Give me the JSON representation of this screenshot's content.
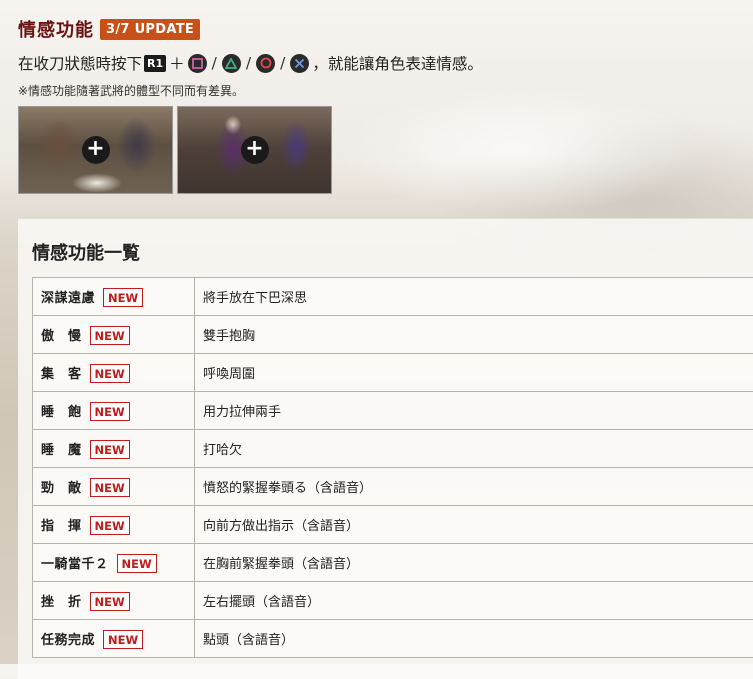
{
  "header": {
    "title": "情感功能",
    "update_badge": "3/7 UPDATE",
    "instruction_prefix": "在收刀狀態時按下",
    "button_r1": "R1",
    "plus_sign": "＋",
    "slash": "/",
    "instruction_suffix": "，就能讓角色表達情感。",
    "note": "※情感功能隨著武將的體型不同而有差異。",
    "buttons": [
      "square-button-icon",
      "triangle-button-icon",
      "circle-button-icon",
      "cross-button-icon"
    ],
    "button_colors": {
      "square": "#d25fa2",
      "triangle": "#3fb28a",
      "circle": "#e5464c",
      "cross": "#6b9ad9"
    }
  },
  "thumbnails": [
    {
      "plus": "+"
    },
    {
      "plus": "+"
    }
  ],
  "section": {
    "title": "情感功能一覧",
    "new_label": "NEW",
    "rows": [
      {
        "name": "深謀遠慮",
        "desc": "將手放在下巴深思"
      },
      {
        "name": "傲　慢",
        "desc": "雙手抱胸"
      },
      {
        "name": "集　客",
        "desc": "呼喚周圍"
      },
      {
        "name": "睡　飽",
        "desc": "用力拉伸兩手"
      },
      {
        "name": "睡　魔",
        "desc": "打哈欠"
      },
      {
        "name": "勁　敵",
        "desc": "憤怒的緊握拳頭る（含語音）"
      },
      {
        "name": "指　揮",
        "desc": "向前方做出指示（含語音）"
      },
      {
        "name": "一騎當千２",
        "desc": "在胸前緊握拳頭（含語音）"
      },
      {
        "name": "挫　折",
        "desc": "左右擺頭（含語音）"
      },
      {
        "name": "任務完成",
        "desc": "點頭（含語音）"
      }
    ]
  }
}
